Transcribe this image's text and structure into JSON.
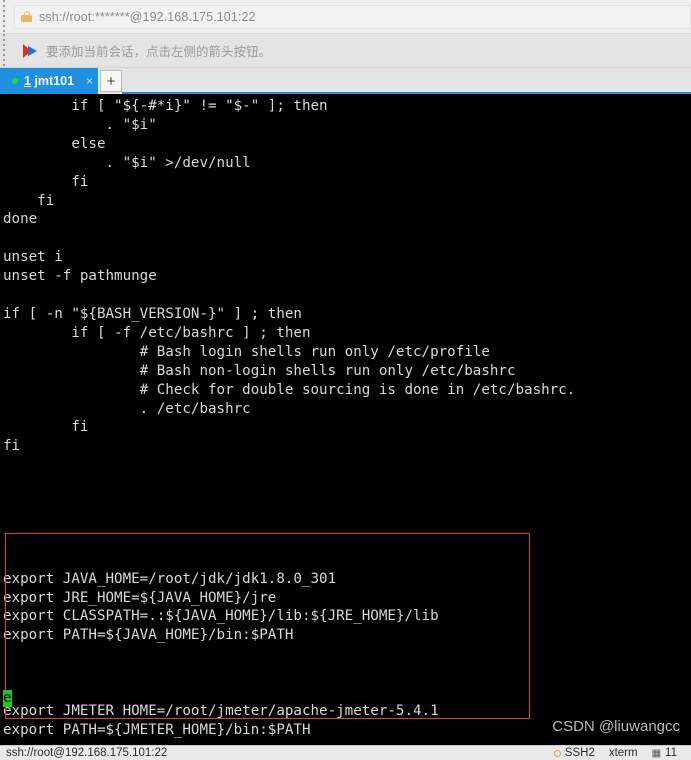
{
  "window": {
    "app": "Xshell SSH terminal"
  },
  "urlbar": {
    "icon": "lock-icon",
    "value": "ssh://root:*******@192.168.175.101:22"
  },
  "notification": {
    "icon": "arrow-flag-icon",
    "message": "要添加当前会话，点击左侧的箭头按钮。"
  },
  "tabbar": {
    "tabs": [
      {
        "index": "1",
        "name": "jmt101",
        "label": "1 jmt101",
        "status_dot_color": "#27d441",
        "close_label": "×",
        "active": true
      }
    ],
    "new_tab_label": "+"
  },
  "terminal": {
    "foreground": "#d8d8d8",
    "background": "#000000",
    "content": "        if [ \"${-#*i}\" != \"$-\" ]; then\n            . \"$i\"\n        else\n            . \"$i\" >/dev/null\n        fi\n    fi\ndone\n\nunset i\nunset -f pathmunge\n\nif [ -n \"${BASH_VERSION-}\" ] ; then\n        if [ -f /etc/bashrc ] ; then\n                # Bash login shells run only /etc/profile\n                # Bash non-login shells run only /etc/bashrc\n                # Check for double sourcing is done in /etc/bashrc.\n                . /etc/bashrc\n        fi\nfi\n\n\n\n\n\n\nexport JAVA_HOME=/root/jdk/jdk1.8.0_301\nexport JRE_HOME=${JAVA_HOME}/jre\nexport CLASSPATH=.:${JAVA_HOME}/lib:${JRE_HOME}/lib\nexport PATH=${JAVA_HOME}/bin:$PATH\n\n\n\nexport JMETER_HOME=/root/jmeter/apache-jmeter-5.4.1\nexport PATH=${JMETER_HOME}/bin:$PATH",
    "cursor": {
      "char": "e",
      "color": "#1ec81e",
      "line": "export PATH=${JMETER_HOME}/bin:$PATH"
    },
    "annotation": {
      "type": "rectangle",
      "color": "#e23b36",
      "encloses": [
        "export JAVA_HOME=/root/jdk/jdk1.8.0_301",
        "export JRE_HOME=${JAVA_HOME}/jre",
        "export CLASSPATH=.:${JAVA_HOME}/lib:${JRE_HOME}/lib",
        "export PATH=${JAVA_HOME}/bin:$PATH",
        "export JMETER_HOME=/root/jmeter/apache-jmeter-5.4.1",
        "export PATH=${JMETER_HOME}/bin:$PATH"
      ]
    }
  },
  "watermark": "CSDN @liuwangcc",
  "statusbar": {
    "connection": "ssh://root@192.168.175.101:22",
    "protocol": "SSH2",
    "encoding": "xterm",
    "size": "11"
  }
}
